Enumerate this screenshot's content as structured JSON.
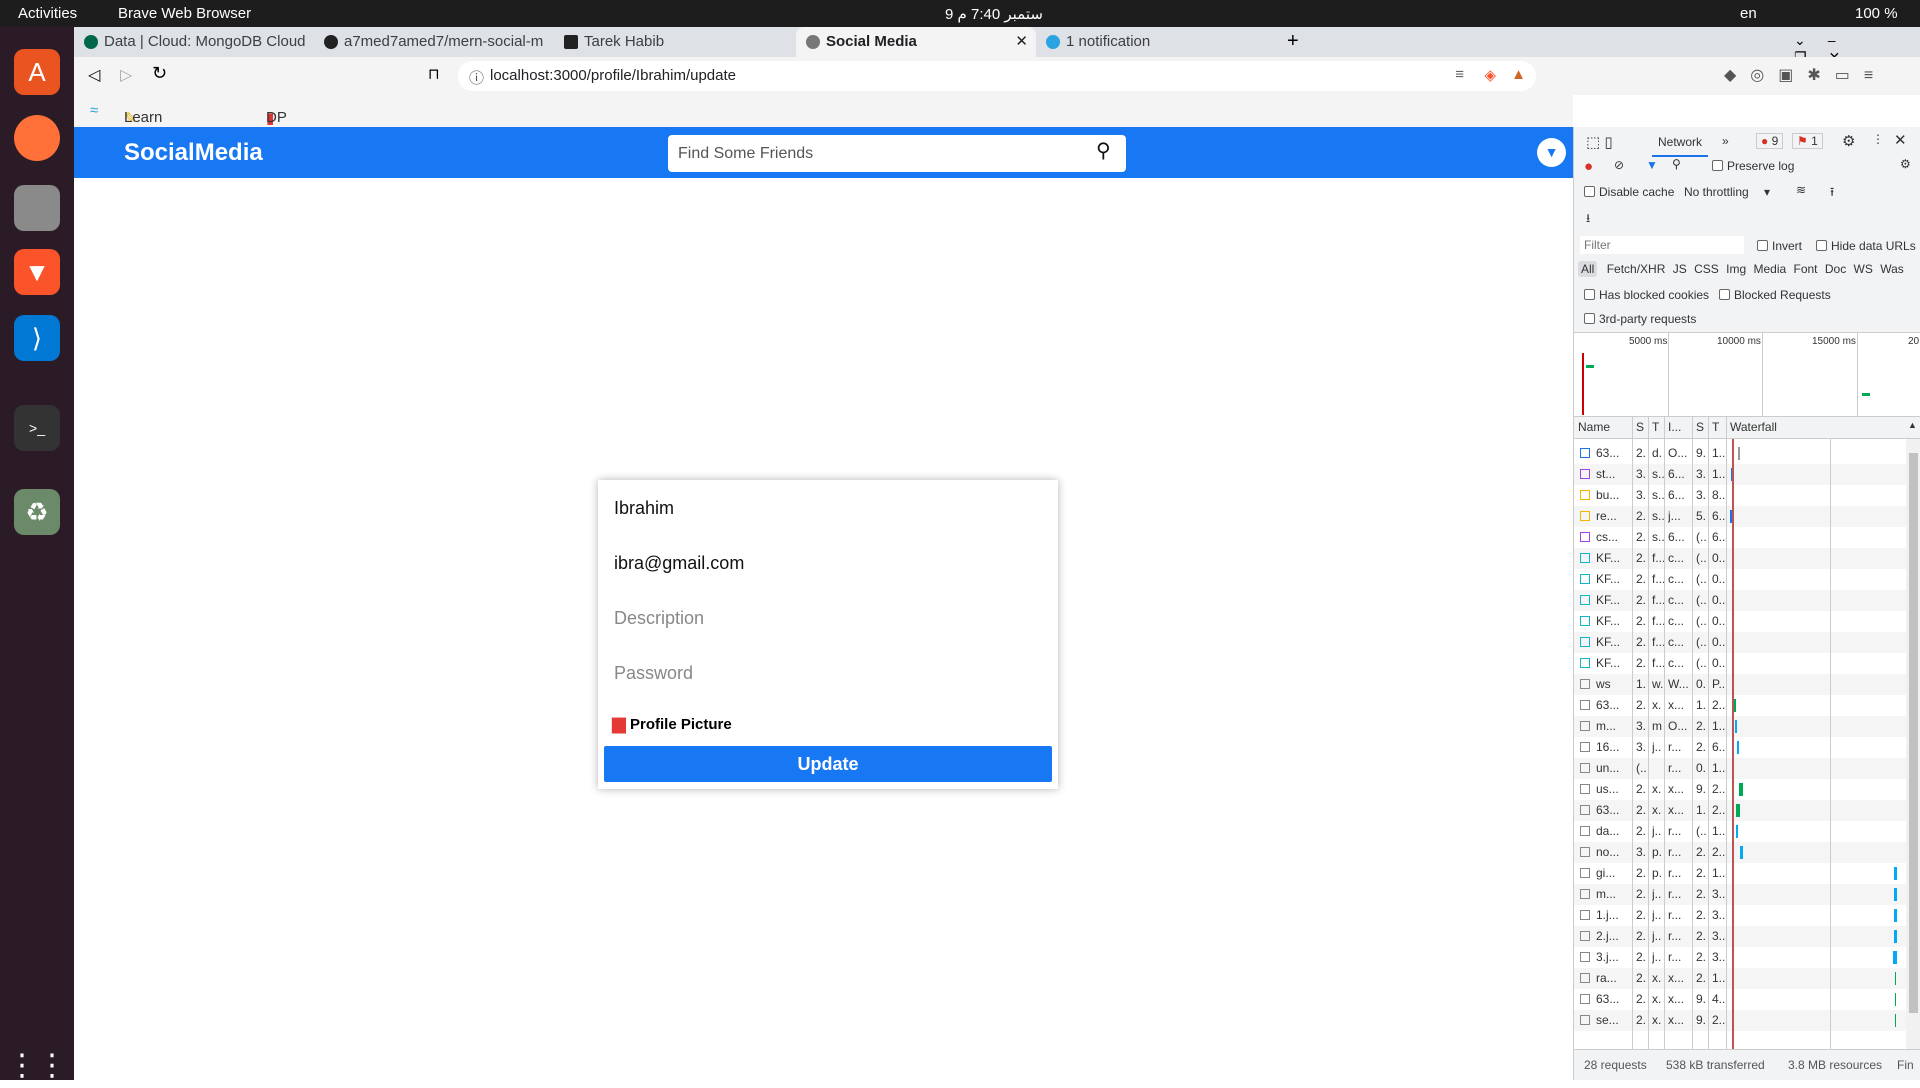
{
  "os": {
    "activities": "Activities",
    "app_name": "Brave Web Browser",
    "clock": "9 ستمبر 7:40 م",
    "lang": "en",
    "battery": "100 %"
  },
  "browser": {
    "tabs": [
      {
        "label": "Data | Cloud: MongoDB Cloud"
      },
      {
        "label": "a7med7amed7/mern-social-m"
      },
      {
        "label": "Tarek Habib"
      },
      {
        "label": "Social Media",
        "active": true
      },
      {
        "label": "1 notification"
      }
    ],
    "url": "localhost:3000/profile/Ibrahim/update",
    "bookmarks": [
      {
        "label": "Learn SQL - O..."
      },
      {
        "label": "DP Tutorial an..."
      }
    ]
  },
  "app": {
    "logo": "SocialMedia",
    "search_placeholder": "Find Some Friends",
    "accent": "#1877f2"
  },
  "form": {
    "name": "Ibrahim",
    "email": "ibra@gmail.com",
    "description_placeholder": "Description",
    "password_placeholder": "Password",
    "profile_picture_label": "Profile Picture",
    "update_label": "Update"
  },
  "devtools": {
    "tab": "Network",
    "errors": "9",
    "warnings": "1",
    "preserve_log": "Preserve log",
    "disable_cache": "Disable cache",
    "throttling": "No throttling",
    "filter_placeholder": "Filter",
    "invert": "Invert",
    "hide_data_urls": "Hide data URLs",
    "types": [
      "All",
      "Fetch/XHR",
      "JS",
      "CSS",
      "Img",
      "Media",
      "Font",
      "Doc",
      "WS",
      "Was"
    ],
    "has_blocked_cookies": "Has blocked cookies",
    "blocked_requests": "Blocked Requests",
    "third_party": "3rd-party requests",
    "timeline_ticks": [
      "5000 ms",
      "10000 ms",
      "15000 ms",
      "20"
    ],
    "columns": [
      "Name",
      "S",
      "T",
      "I...",
      "S",
      "T",
      "Waterfall"
    ],
    "rows": [
      [
        "63...",
        "2.",
        "d.",
        "O...",
        "9.",
        "1.."
      ],
      [
        "st...",
        "3.",
        "s..",
        "6...",
        "3.",
        "1.."
      ],
      [
        "bu...",
        "3.",
        "s..",
        "6...",
        "3.",
        "8.."
      ],
      [
        "re...",
        "2.",
        "s..",
        "j...",
        "5.",
        "6.."
      ],
      [
        "cs...",
        "2.",
        "s..",
        "6...",
        "(..",
        "6.."
      ],
      [
        "KF...",
        "2.",
        "f...",
        "c...",
        "(..",
        "0.."
      ],
      [
        "KF...",
        "2.",
        "f...",
        "c...",
        "(..",
        "0.."
      ],
      [
        "KF...",
        "2.",
        "f...",
        "c...",
        "(..",
        "0.."
      ],
      [
        "KF...",
        "2.",
        "f...",
        "c...",
        "(..",
        "0.."
      ],
      [
        "KF...",
        "2.",
        "f...",
        "c...",
        "(..",
        "0.."
      ],
      [
        "KF...",
        "2.",
        "f...",
        "c...",
        "(..",
        "0.."
      ],
      [
        "ws",
        "1.",
        "w.",
        "W...",
        "0.",
        "P.."
      ],
      [
        "63...",
        "2.",
        "x.",
        "x...",
        "1.",
        "2.."
      ],
      [
        "m...",
        "3.",
        "m",
        "O...",
        "2.",
        "1.."
      ],
      [
        "16...",
        "3.",
        "j..",
        "r...",
        "2.",
        "6.."
      ],
      [
        "un...",
        "(..",
        "",
        "r...",
        "0.",
        "1.."
      ],
      [
        "us...",
        "2.",
        "x.",
        "x...",
        "9.",
        "2.."
      ],
      [
        "63...",
        "2.",
        "x.",
        "x...",
        "1.",
        "2.."
      ],
      [
        "da...",
        "2.",
        "j..",
        "r...",
        "(..",
        "1.."
      ],
      [
        "no...",
        "3.",
        "p.",
        "r...",
        "2.",
        "2.."
      ],
      [
        "gi...",
        "2.",
        "p.",
        "r...",
        "2.",
        "1.."
      ],
      [
        "m...",
        "2.",
        "j..",
        "r...",
        "2.",
        "3.."
      ],
      [
        "1.j...",
        "2.",
        "j..",
        "r...",
        "2.",
        "3.."
      ],
      [
        "2.j...",
        "2.",
        "j..",
        "r...",
        "2.",
        "3.."
      ],
      [
        "3.j...",
        "2.",
        "j..",
        "r...",
        "2.",
        "3.."
      ],
      [
        "ra...",
        "2.",
        "x.",
        "x...",
        "2.",
        "1.."
      ],
      [
        "63...",
        "2.",
        "x.",
        "x...",
        "9.",
        "4.."
      ],
      [
        "se...",
        "2.",
        "x.",
        "x...",
        "9.",
        "2.."
      ]
    ],
    "summary": {
      "requests": "28 requests",
      "transferred": "538 kB transferred",
      "resources": "3.8 MB resources",
      "finish": "Fin"
    }
  }
}
